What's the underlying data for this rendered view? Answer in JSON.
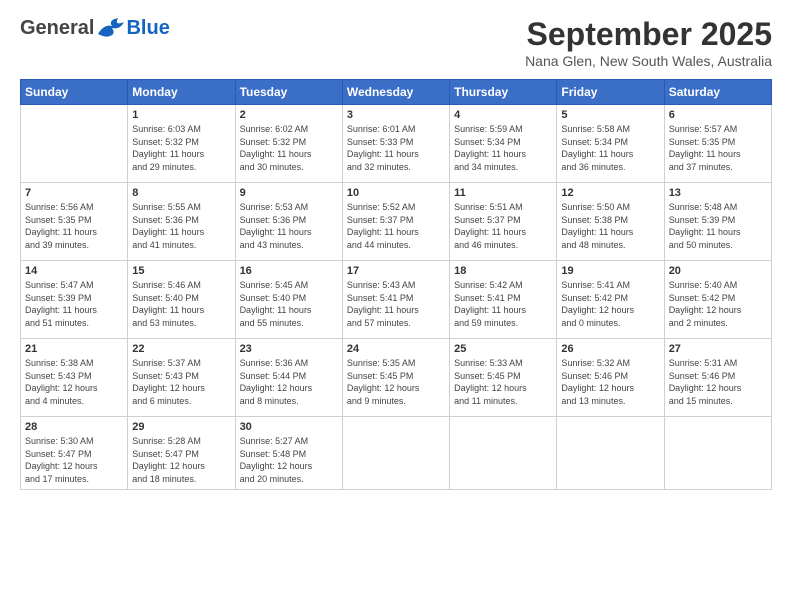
{
  "header": {
    "logo_general": "General",
    "logo_blue": "Blue",
    "month_title": "September 2025",
    "location": "Nana Glen, New South Wales, Australia"
  },
  "weekdays": [
    "Sunday",
    "Monday",
    "Tuesday",
    "Wednesday",
    "Thursday",
    "Friday",
    "Saturday"
  ],
  "weeks": [
    [
      {
        "day": "",
        "info": ""
      },
      {
        "day": "1",
        "info": "Sunrise: 6:03 AM\nSunset: 5:32 PM\nDaylight: 11 hours\nand 29 minutes."
      },
      {
        "day": "2",
        "info": "Sunrise: 6:02 AM\nSunset: 5:32 PM\nDaylight: 11 hours\nand 30 minutes."
      },
      {
        "day": "3",
        "info": "Sunrise: 6:01 AM\nSunset: 5:33 PM\nDaylight: 11 hours\nand 32 minutes."
      },
      {
        "day": "4",
        "info": "Sunrise: 5:59 AM\nSunset: 5:34 PM\nDaylight: 11 hours\nand 34 minutes."
      },
      {
        "day": "5",
        "info": "Sunrise: 5:58 AM\nSunset: 5:34 PM\nDaylight: 11 hours\nand 36 minutes."
      },
      {
        "day": "6",
        "info": "Sunrise: 5:57 AM\nSunset: 5:35 PM\nDaylight: 11 hours\nand 37 minutes."
      }
    ],
    [
      {
        "day": "7",
        "info": "Sunrise: 5:56 AM\nSunset: 5:35 PM\nDaylight: 11 hours\nand 39 minutes."
      },
      {
        "day": "8",
        "info": "Sunrise: 5:55 AM\nSunset: 5:36 PM\nDaylight: 11 hours\nand 41 minutes."
      },
      {
        "day": "9",
        "info": "Sunrise: 5:53 AM\nSunset: 5:36 PM\nDaylight: 11 hours\nand 43 minutes."
      },
      {
        "day": "10",
        "info": "Sunrise: 5:52 AM\nSunset: 5:37 PM\nDaylight: 11 hours\nand 44 minutes."
      },
      {
        "day": "11",
        "info": "Sunrise: 5:51 AM\nSunset: 5:37 PM\nDaylight: 11 hours\nand 46 minutes."
      },
      {
        "day": "12",
        "info": "Sunrise: 5:50 AM\nSunset: 5:38 PM\nDaylight: 11 hours\nand 48 minutes."
      },
      {
        "day": "13",
        "info": "Sunrise: 5:48 AM\nSunset: 5:39 PM\nDaylight: 11 hours\nand 50 minutes."
      }
    ],
    [
      {
        "day": "14",
        "info": "Sunrise: 5:47 AM\nSunset: 5:39 PM\nDaylight: 11 hours\nand 51 minutes."
      },
      {
        "day": "15",
        "info": "Sunrise: 5:46 AM\nSunset: 5:40 PM\nDaylight: 11 hours\nand 53 minutes."
      },
      {
        "day": "16",
        "info": "Sunrise: 5:45 AM\nSunset: 5:40 PM\nDaylight: 11 hours\nand 55 minutes."
      },
      {
        "day": "17",
        "info": "Sunrise: 5:43 AM\nSunset: 5:41 PM\nDaylight: 11 hours\nand 57 minutes."
      },
      {
        "day": "18",
        "info": "Sunrise: 5:42 AM\nSunset: 5:41 PM\nDaylight: 11 hours\nand 59 minutes."
      },
      {
        "day": "19",
        "info": "Sunrise: 5:41 AM\nSunset: 5:42 PM\nDaylight: 12 hours\nand 0 minutes."
      },
      {
        "day": "20",
        "info": "Sunrise: 5:40 AM\nSunset: 5:42 PM\nDaylight: 12 hours\nand 2 minutes."
      }
    ],
    [
      {
        "day": "21",
        "info": "Sunrise: 5:38 AM\nSunset: 5:43 PM\nDaylight: 12 hours\nand 4 minutes."
      },
      {
        "day": "22",
        "info": "Sunrise: 5:37 AM\nSunset: 5:43 PM\nDaylight: 12 hours\nand 6 minutes."
      },
      {
        "day": "23",
        "info": "Sunrise: 5:36 AM\nSunset: 5:44 PM\nDaylight: 12 hours\nand 8 minutes."
      },
      {
        "day": "24",
        "info": "Sunrise: 5:35 AM\nSunset: 5:45 PM\nDaylight: 12 hours\nand 9 minutes."
      },
      {
        "day": "25",
        "info": "Sunrise: 5:33 AM\nSunset: 5:45 PM\nDaylight: 12 hours\nand 11 minutes."
      },
      {
        "day": "26",
        "info": "Sunrise: 5:32 AM\nSunset: 5:46 PM\nDaylight: 12 hours\nand 13 minutes."
      },
      {
        "day": "27",
        "info": "Sunrise: 5:31 AM\nSunset: 5:46 PM\nDaylight: 12 hours\nand 15 minutes."
      }
    ],
    [
      {
        "day": "28",
        "info": "Sunrise: 5:30 AM\nSunset: 5:47 PM\nDaylight: 12 hours\nand 17 minutes."
      },
      {
        "day": "29",
        "info": "Sunrise: 5:28 AM\nSunset: 5:47 PM\nDaylight: 12 hours\nand 18 minutes."
      },
      {
        "day": "30",
        "info": "Sunrise: 5:27 AM\nSunset: 5:48 PM\nDaylight: 12 hours\nand 20 minutes."
      },
      {
        "day": "",
        "info": ""
      },
      {
        "day": "",
        "info": ""
      },
      {
        "day": "",
        "info": ""
      },
      {
        "day": "",
        "info": ""
      }
    ]
  ]
}
